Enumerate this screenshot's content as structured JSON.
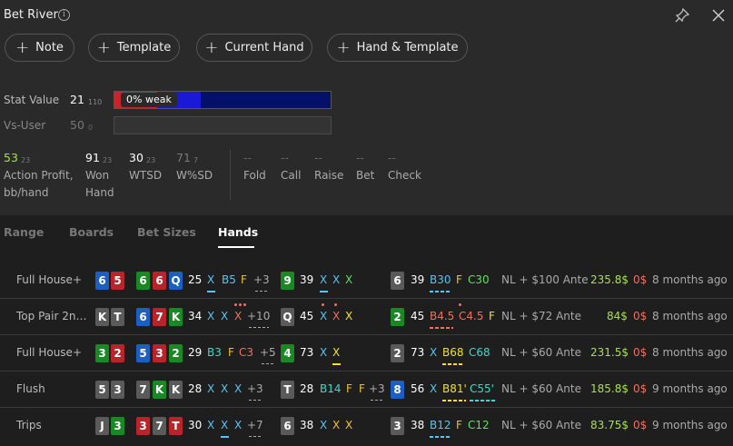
{
  "header": {
    "title": "Bet River",
    "info_icon": "i"
  },
  "buttons": [
    "Note",
    "Template",
    "Current Hand",
    "Hand & Template"
  ],
  "stat": {
    "label": "Stat Value",
    "value": "21",
    "sub": "110",
    "bar_label": "0% weak",
    "vs_label": "Vs-User",
    "vs_value": "50",
    "vs_sub": "0"
  },
  "metrics": [
    {
      "value": "53",
      "sub": "23",
      "label1": "Action Profit,",
      "label2": "bb/hand",
      "color": "#a8e04a"
    },
    {
      "value": "91",
      "sub": "23",
      "label1": "Won",
      "label2": "Hand",
      "color": "#ffffff"
    },
    {
      "value": "30",
      "sub": "23",
      "label1": "WTSD",
      "label2": "",
      "color": "#ffffff"
    },
    {
      "value": "71",
      "sub": "7",
      "label1": "W%SD",
      "label2": "",
      "color": "#777777"
    }
  ],
  "actions": [
    {
      "value": "--",
      "label": "Fold"
    },
    {
      "value": "--",
      "label": "Call"
    },
    {
      "value": "--",
      "label": "Raise"
    },
    {
      "value": "--",
      "label": "Bet"
    },
    {
      "value": "--",
      "label": "Check"
    }
  ],
  "tabs": [
    "Range",
    "Boards",
    "Bet Sizes",
    "Hands"
  ],
  "rows": [
    {
      "label": "Full House+",
      "hole": [
        "6",
        "5"
      ],
      "flop": [
        "6",
        "6",
        "Q"
      ],
      "flop_pot": "25",
      "flop_actions": [
        "X",
        "B5",
        "F",
        "+3"
      ],
      "turn": [
        "9"
      ],
      "turn_pot": "39",
      "turn_actions": [
        "X",
        "X",
        "X"
      ],
      "river": [
        "6"
      ],
      "river_pot": "39",
      "river_actions": [
        "B30",
        "F",
        "C30"
      ],
      "game": "NL + $100 Ante",
      "won": "235.8$",
      "rake": "0$",
      "time": "8 months ago"
    },
    {
      "label": "Top Pair 2nd...",
      "hole": [
        "K",
        "T"
      ],
      "flop": [
        "6",
        "7",
        "K"
      ],
      "flop_pot": "34",
      "flop_actions": [
        "X",
        "X",
        "X",
        "+10"
      ],
      "turn": [
        "Q"
      ],
      "turn_pot": "45",
      "turn_actions": [
        "X",
        "X",
        "X"
      ],
      "river": [
        "2"
      ],
      "river_pot": "45",
      "river_actions": [
        "B4.5",
        "C4.5",
        "F"
      ],
      "game": "NL + $72 Ante",
      "won": "84$",
      "rake": "0$",
      "time": "8 months ago"
    },
    {
      "label": "Full House+",
      "hole": [
        "3",
        "2"
      ],
      "flop": [
        "5",
        "3",
        "2"
      ],
      "flop_pot": "29",
      "flop_actions": [
        "B3",
        "F",
        "C3",
        "+5"
      ],
      "turn": [
        "4"
      ],
      "turn_pot": "73",
      "turn_actions": [
        "X",
        "X"
      ],
      "river": [
        "2"
      ],
      "river_pot": "73",
      "river_actions": [
        "X",
        "B68",
        "C68"
      ],
      "game": "NL + $60 Ante",
      "won": "231.5$",
      "rake": "0$",
      "time": "8 months ago"
    },
    {
      "label": "Flush",
      "hole": [
        "5",
        "3"
      ],
      "flop": [
        "7",
        "K",
        "K"
      ],
      "flop_pot": "28",
      "flop_actions": [
        "X",
        "X",
        "X",
        "+3"
      ],
      "turn": [
        "T"
      ],
      "turn_pot": "28",
      "turn_actions": [
        "B14",
        "F",
        "F",
        "+3"
      ],
      "river": [
        "8"
      ],
      "river_pot": "56",
      "river_actions": [
        "X",
        "B81'",
        "C55'"
      ],
      "game": "NL + $60 Ante",
      "won": "185.8$",
      "rake": "0$",
      "time": "9 months ago"
    },
    {
      "label": "Trips",
      "hole": [
        "J",
        "3"
      ],
      "flop": [
        "3",
        "7",
        "T"
      ],
      "flop_pot": "30",
      "flop_actions": [
        "X",
        "X",
        "X",
        "+7"
      ],
      "turn": [
        "6"
      ],
      "turn_pot": "38",
      "turn_actions": [
        "X",
        "X",
        "X"
      ],
      "river": [
        "3"
      ],
      "river_pot": "38",
      "river_actions": [
        "B12",
        "F",
        "C12"
      ],
      "game": "NL + $60 Ante",
      "won": "83.75$",
      "rake": "0$",
      "time": "9 months ago"
    }
  ]
}
